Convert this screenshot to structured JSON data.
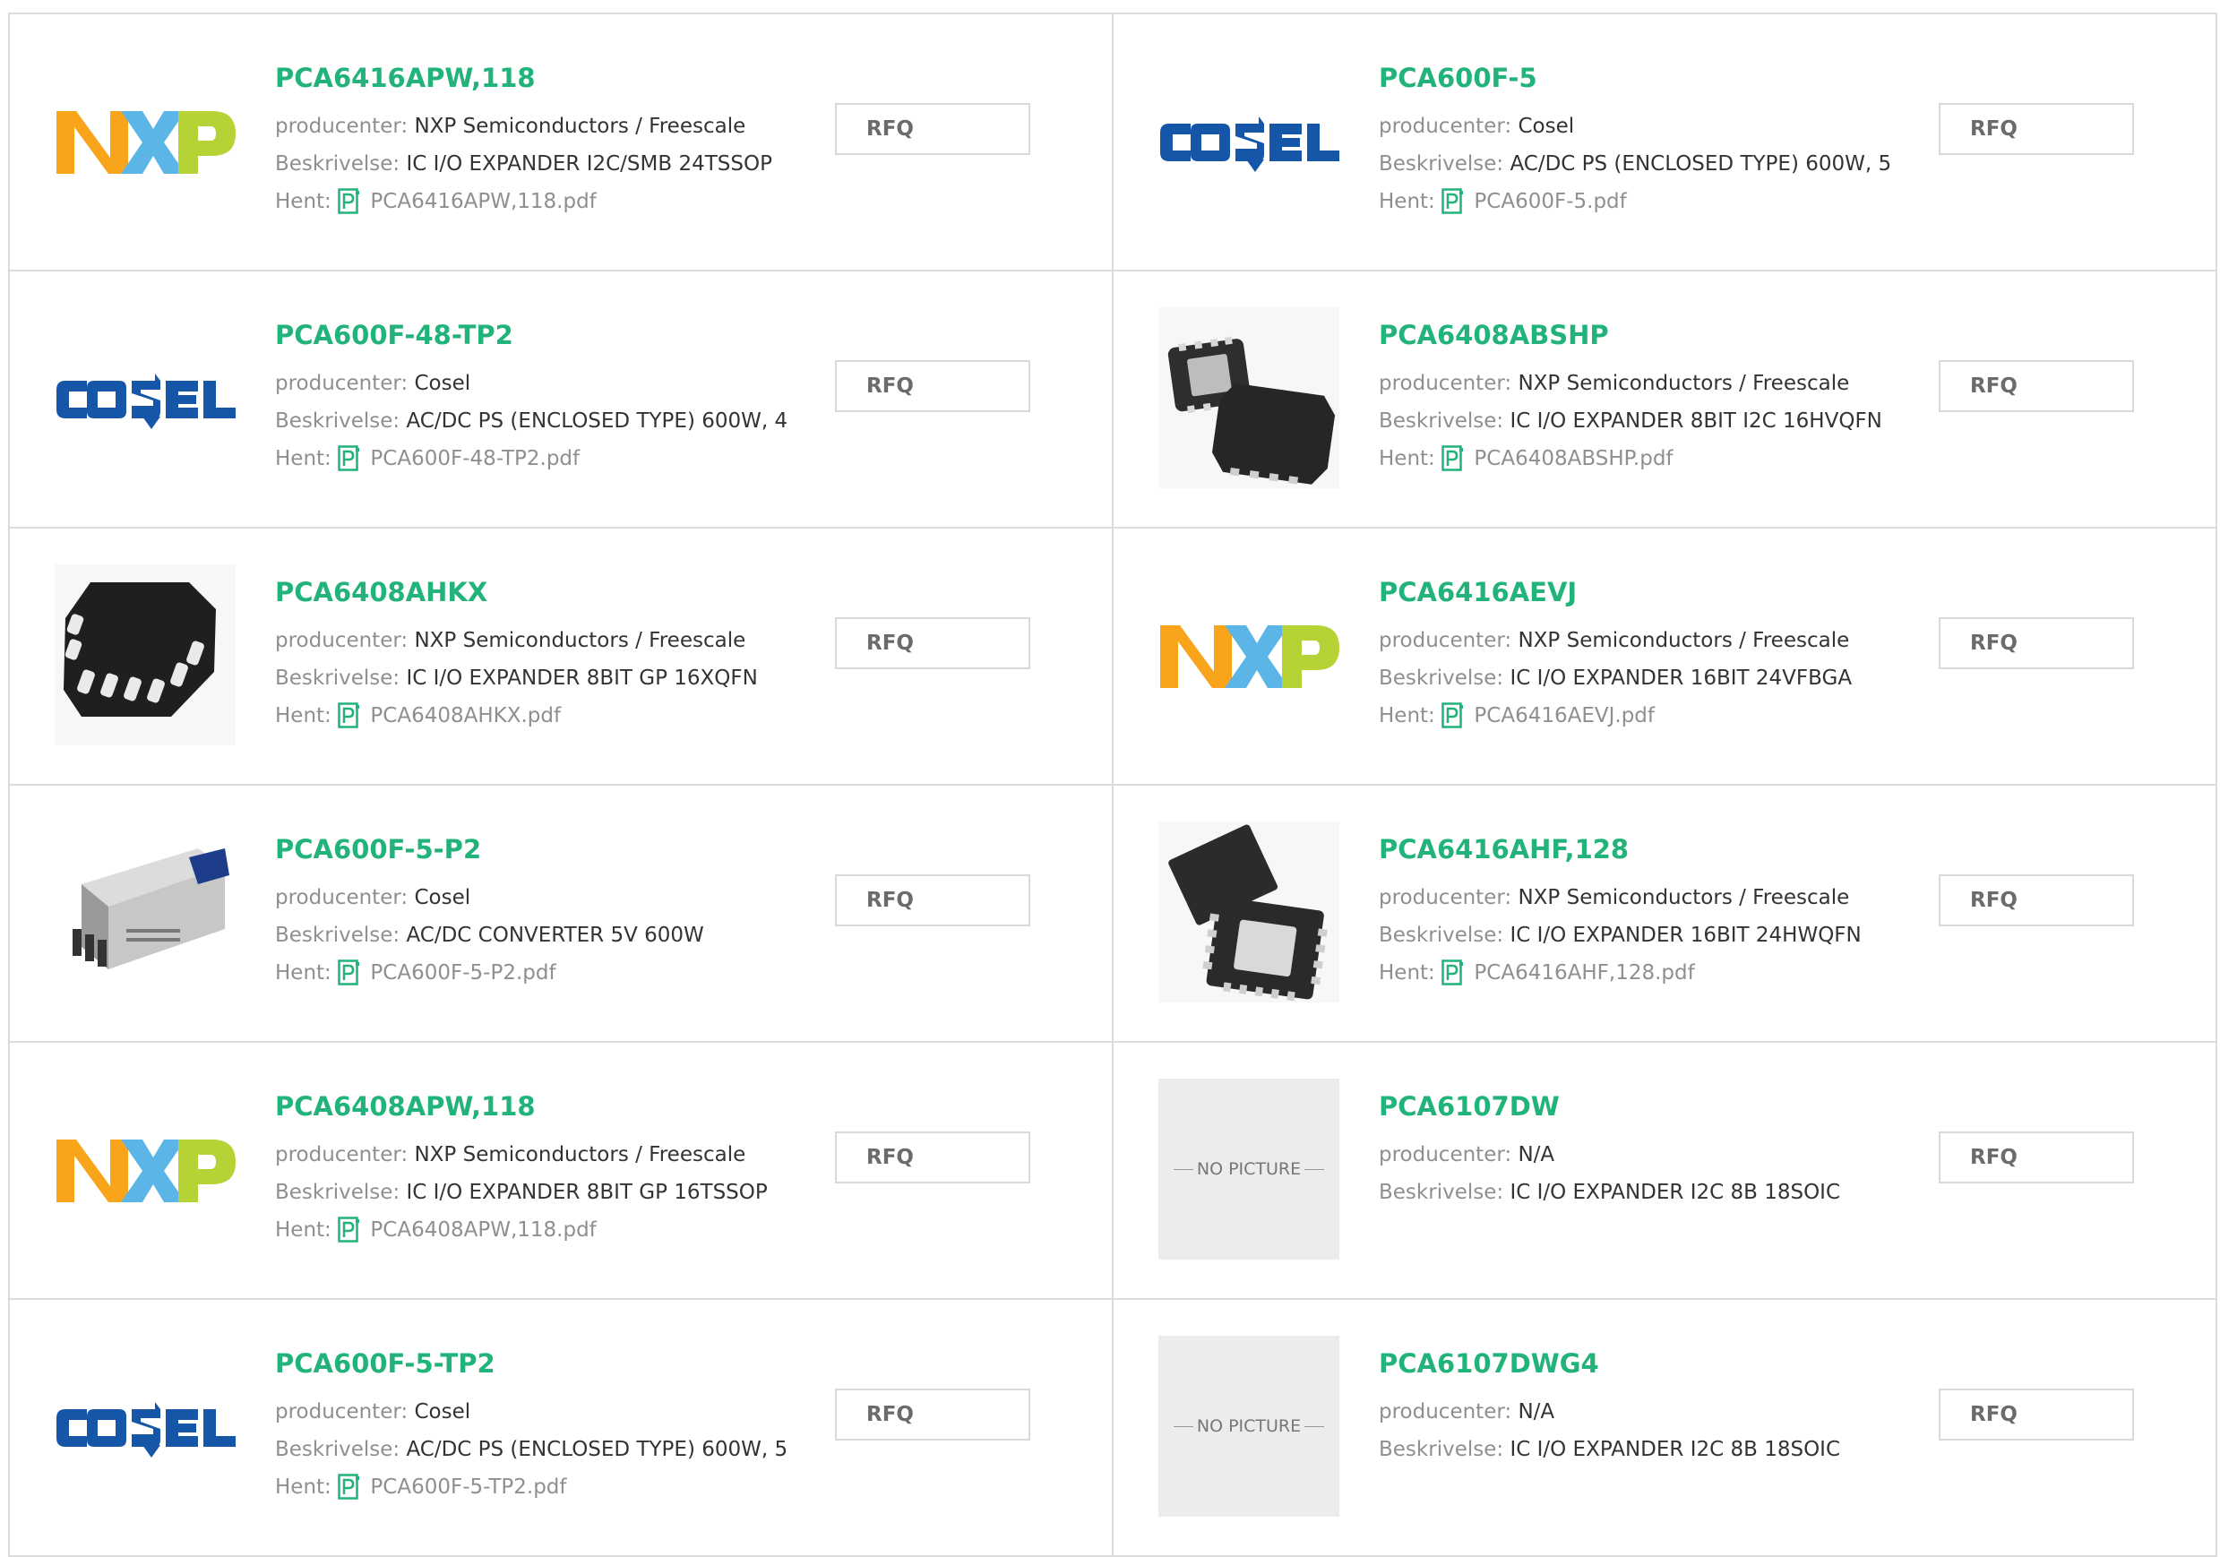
{
  "labels": {
    "manufacturer": "producenter:",
    "description": "Beskrivelse:",
    "download": "Hent:",
    "rfq": "RFQ",
    "no_picture": "NO PICTURE"
  },
  "colors": {
    "part_link": "#21b37a",
    "cosel_blue": "#1556a8",
    "nxp_orange": "#f9a51b",
    "nxp_blue": "#5bb5e6",
    "nxp_green": "#b5d334"
  },
  "products": [
    {
      "part": "PCA6416APW,118",
      "manufacturer": "NXP Semiconductors / Freescale",
      "description": "IC I/O EXPANDER I2C/SMB 24TSSOP",
      "file": "PCA6416APW,118.pdf",
      "image": "nxp-logo"
    },
    {
      "part": "PCA600F-5",
      "manufacturer": "Cosel",
      "description": "AC/DC PS (ENCLOSED TYPE) 600W, 5",
      "file": "PCA600F-5.pdf",
      "image": "cosel-logo"
    },
    {
      "part": "PCA600F-48-TP2",
      "manufacturer": "Cosel",
      "description": "AC/DC PS (ENCLOSED TYPE) 600W, 4",
      "file": "PCA600F-48-TP2.pdf",
      "image": "cosel-logo"
    },
    {
      "part": "PCA6408ABSHP",
      "manufacturer": "NXP Semiconductors / Freescale",
      "description": "IC I/O EXPANDER 8BIT I2C 16HVQFN",
      "file": "PCA6408ABSHP.pdf",
      "image": "qfn-pair"
    },
    {
      "part": "PCA6408AHKX",
      "manufacturer": "NXP Semiconductors / Freescale",
      "description": "IC I/O EXPANDER 8BIT GP 16XQFN",
      "file": "PCA6408AHKX.pdf",
      "image": "xqfn-chip"
    },
    {
      "part": "PCA6416AEVJ",
      "manufacturer": "NXP Semiconductors / Freescale",
      "description": "IC I/O EXPANDER 16BIT 24VFBGA",
      "file": "PCA6416AEVJ.pdf",
      "image": "nxp-logo"
    },
    {
      "part": "PCA600F-5-P2",
      "manufacturer": "Cosel",
      "description": "AC/DC CONVERTER 5V 600W",
      "file": "PCA600F-5-P2.pdf",
      "image": "power-supply"
    },
    {
      "part": "PCA6416AHF,128",
      "manufacturer": "NXP Semiconductors / Freescale",
      "description": "IC I/O EXPANDER 16BIT 24HWQFN",
      "file": "PCA6416AHF,128.pdf",
      "image": "qfn-pair-large"
    },
    {
      "part": "PCA6408APW,118",
      "manufacturer": "NXP Semiconductors / Freescale",
      "description": "IC I/O EXPANDER 8BIT GP 16TSSOP",
      "file": "PCA6408APW,118.pdf",
      "image": "nxp-logo"
    },
    {
      "part": "PCA6107DW",
      "manufacturer": "N/A",
      "description": "IC I/O EXPANDER I2C 8B 18SOIC",
      "file": null,
      "image": "no-picture"
    },
    {
      "part": "PCA600F-5-TP2",
      "manufacturer": "Cosel",
      "description": "AC/DC PS (ENCLOSED TYPE) 600W, 5",
      "file": "PCA600F-5-TP2.pdf",
      "image": "cosel-logo"
    },
    {
      "part": "PCA6107DWG4",
      "manufacturer": "N/A",
      "description": "IC I/O EXPANDER I2C 8B 18SOIC",
      "file": null,
      "image": "no-picture"
    }
  ]
}
